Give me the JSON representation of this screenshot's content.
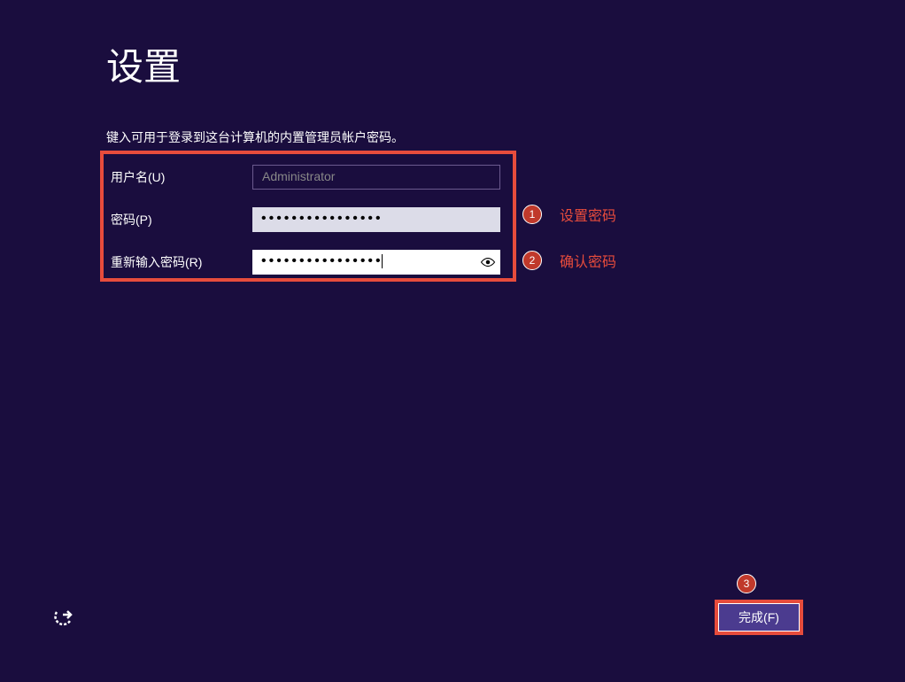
{
  "page": {
    "title": "设置",
    "instruction": "键入可用于登录到这台计算机的内置管理员帐户密码。"
  },
  "form": {
    "username": {
      "label": "用户名(U)",
      "value": "Administrator"
    },
    "password": {
      "label": "密码(P)",
      "masked_value": "••••••••••••••••"
    },
    "confirm": {
      "label": "重新输入密码(R)",
      "masked_value": "••••••••••••••••"
    }
  },
  "annotations": {
    "annotation1": {
      "number": "1",
      "text": "设置密码"
    },
    "annotation2": {
      "number": "2",
      "text": "确认密码"
    },
    "annotation3": {
      "number": "3"
    }
  },
  "buttons": {
    "finish": "完成(F)"
  }
}
